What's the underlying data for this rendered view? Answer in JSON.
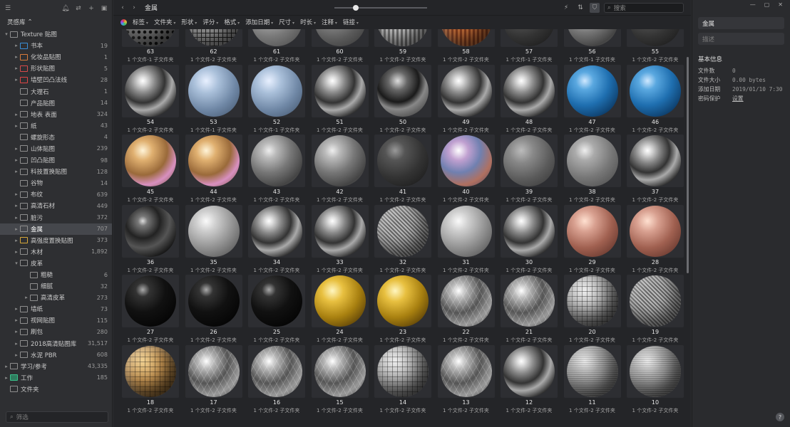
{
  "sidebar": {
    "library": "灵感库",
    "search_placeholder": "筛选",
    "items": [
      {
        "label": "Texture 贴图",
        "count": "",
        "depth": 0,
        "arrow": "▾",
        "icon": "folder-icon"
      },
      {
        "label": "书本",
        "count": "19",
        "depth": 1,
        "arrow": "▸",
        "icon": "book-icon"
      },
      {
        "label": "化妆品贴图",
        "count": "1",
        "depth": 1,
        "arrow": "▸",
        "icon": "cosmetics-icon"
      },
      {
        "label": "形状贴图",
        "count": "5",
        "depth": 1,
        "arrow": "▸",
        "icon": "shape-icon"
      },
      {
        "label": "墙壁凹凸法线",
        "count": "28",
        "depth": 1,
        "arrow": "▸",
        "icon": "warning-icon"
      },
      {
        "label": "大理石",
        "count": "1",
        "depth": 1,
        "arrow": "",
        "icon": "folder-icon"
      },
      {
        "label": "产品贴图",
        "count": "14",
        "depth": 1,
        "arrow": "",
        "icon": "folder-icon"
      },
      {
        "label": "地表 表面",
        "count": "324",
        "depth": 1,
        "arrow": "▸",
        "icon": "folder-icon"
      },
      {
        "label": "纸",
        "count": "43",
        "depth": 1,
        "arrow": "▸",
        "icon": "folder-icon"
      },
      {
        "label": "螺旋形态",
        "count": "4",
        "depth": 1,
        "arrow": "",
        "icon": "folder-icon"
      },
      {
        "label": "山体贴图",
        "count": "239",
        "depth": 1,
        "arrow": "▸",
        "icon": "folder-icon"
      },
      {
        "label": "凹凸贴图",
        "count": "98",
        "depth": 1,
        "arrow": "▸",
        "icon": "folder-icon"
      },
      {
        "label": "科技置换贴图",
        "count": "128",
        "depth": 1,
        "arrow": "▸",
        "icon": "folder-icon"
      },
      {
        "label": "谷物",
        "count": "14",
        "depth": 1,
        "arrow": "",
        "icon": "folder-icon"
      },
      {
        "label": "布纹",
        "count": "639",
        "depth": 1,
        "arrow": "▸",
        "icon": "folder-icon"
      },
      {
        "label": "高清石材",
        "count": "449",
        "depth": 1,
        "arrow": "▸",
        "icon": "folder-icon"
      },
      {
        "label": "脏污",
        "count": "372",
        "depth": 1,
        "arrow": "▸",
        "icon": "folder-icon"
      },
      {
        "label": "金属",
        "count": "707",
        "depth": 1,
        "arrow": "▸",
        "icon": "folder-icon",
        "selected": true
      },
      {
        "label": "高强度置换贴图",
        "count": "373",
        "depth": 1,
        "arrow": "▸",
        "icon": "displacement-icon"
      },
      {
        "label": "木材",
        "count": "1,892",
        "depth": 1,
        "arrow": "▸",
        "icon": "folder-icon"
      },
      {
        "label": "皮革",
        "count": "",
        "depth": 1,
        "arrow": "▾",
        "icon": "folder-icon"
      },
      {
        "label": "粗糙",
        "count": "6",
        "depth": 2,
        "arrow": "",
        "icon": "folder-icon"
      },
      {
        "label": "细腻",
        "count": "32",
        "depth": 2,
        "arrow": "",
        "icon": "folder-icon"
      },
      {
        "label": "高清皮革",
        "count": "273",
        "depth": 2,
        "arrow": "▸",
        "icon": "folder-icon"
      },
      {
        "label": "墙纸",
        "count": "73",
        "depth": 1,
        "arrow": "▸",
        "icon": "folder-icon"
      },
      {
        "label": "视网贴图",
        "count": "115",
        "depth": 1,
        "arrow": "▸",
        "icon": "folder-icon"
      },
      {
        "label": "刷包",
        "count": "280",
        "depth": 1,
        "arrow": "▸",
        "icon": "folder-icon"
      },
      {
        "label": "2018高清贴图库",
        "count": "31,517",
        "depth": 1,
        "arrow": "▸",
        "icon": "folder-icon"
      },
      {
        "label": "水泥 PBR",
        "count": "608",
        "depth": 1,
        "arrow": "▸",
        "icon": "folder-icon"
      },
      {
        "label": "学习/参考",
        "count": "43,335",
        "depth": 0,
        "arrow": "▸",
        "icon": "folder-icon"
      },
      {
        "label": "工作",
        "count": "185",
        "depth": 0,
        "arrow": "▸",
        "icon": "work-icon"
      },
      {
        "label": "文件夹",
        "count": "",
        "depth": 0,
        "arrow": "",
        "icon": "folder-icon"
      }
    ]
  },
  "toolbar": {
    "title": "金属",
    "search_placeholder": "搜索",
    "zoom_level": 0.2
  },
  "filters": [
    "标签",
    "文件夹",
    "形状",
    "评分",
    "格式",
    "添加日期",
    "尺寸",
    "时长",
    "注释",
    "链接"
  ],
  "items": [
    {
      "name": "63",
      "sub": "1 个文件-1 子文件夹",
      "mat": "perforated"
    },
    {
      "name": "62",
      "sub": "1 个文件-2 子文件夹",
      "mat": "grid"
    },
    {
      "name": "61",
      "sub": "1 个文件-2 子文件夹",
      "mat": "scuffed"
    },
    {
      "name": "60",
      "sub": "1 个文件-2 子文件夹",
      "mat": "rough"
    },
    {
      "name": "59",
      "sub": "1 个文件-2 子文件夹",
      "mat": "stripes"
    },
    {
      "name": "58",
      "sub": "1 个文件-2 子文件夹",
      "mat": "rust"
    },
    {
      "name": "57",
      "sub": "1 个文件-1 子文件夹",
      "mat": "dark"
    },
    {
      "name": "56",
      "sub": "1 个文件-1 子文件夹",
      "mat": "steel"
    },
    {
      "name": "55",
      "sub": "1 个文件-2 子文件夹",
      "mat": "dark"
    },
    {
      "name": "54",
      "sub": "1 个文件-2 子文件夹",
      "mat": "chrome"
    },
    {
      "name": "53",
      "sub": "1 个文件-1 子文件夹",
      "mat": "bluetile"
    },
    {
      "name": "52",
      "sub": "1 个文件-1 子文件夹",
      "mat": "bluetile"
    },
    {
      "name": "51",
      "sub": "1 个文件-2 子文件夹",
      "mat": "chrome"
    },
    {
      "name": "50",
      "sub": "1 个文件-2 子文件夹",
      "mat": "marble"
    },
    {
      "name": "49",
      "sub": "1 个文件-2 子文件夹",
      "mat": "chrome"
    },
    {
      "name": "48",
      "sub": "1 个文件-2 子文件夹",
      "mat": "chrome"
    },
    {
      "name": "47",
      "sub": "1 个文件-2 子文件夹",
      "mat": "blue"
    },
    {
      "name": "46",
      "sub": "1 个文件-2 子文件夹",
      "mat": "blue"
    },
    {
      "name": "45",
      "sub": "1 个文件-2 子文件夹",
      "mat": "oil"
    },
    {
      "name": "44",
      "sub": "1 个文件-2 子文件夹",
      "mat": "oil"
    },
    {
      "name": "43",
      "sub": "1 个文件-2 子文件夹",
      "mat": "steel"
    },
    {
      "name": "42",
      "sub": "1 个文件-2 子文件夹",
      "mat": "steel"
    },
    {
      "name": "41",
      "sub": "1 个文件-2 子文件夹",
      "mat": "dark"
    },
    {
      "name": "40",
      "sub": "1 个文件-2 子文件夹",
      "mat": "iridescent"
    },
    {
      "name": "39",
      "sub": "1 个文件-2 子文件夹",
      "mat": "rough"
    },
    {
      "name": "38",
      "sub": "1 个文件-2 子文件夹",
      "mat": "scuffed"
    },
    {
      "name": "37",
      "sub": "1 个文件-2 子文件夹",
      "mat": "chrome"
    },
    {
      "name": "36",
      "sub": "1 个文件-2 子文件夹",
      "mat": "darkchrome"
    },
    {
      "name": "35",
      "sub": "1 个文件-2 子文件夹",
      "mat": "silver"
    },
    {
      "name": "34",
      "sub": "1 个文件-2 子文件夹",
      "mat": "chrome"
    },
    {
      "name": "33",
      "sub": "1 个文件-2 子文件夹",
      "mat": "chrome"
    },
    {
      "name": "32",
      "sub": "1 个文件-2 子文件夹",
      "mat": "woven"
    },
    {
      "name": "31",
      "sub": "1 个文件-2 子文件夹",
      "mat": "silver"
    },
    {
      "name": "30",
      "sub": "1 个文件-2 子文件夹",
      "mat": "chrome"
    },
    {
      "name": "29",
      "sub": "1 个文件-2 子文件夹",
      "mat": "copper"
    },
    {
      "name": "28",
      "sub": "1 个文件-2 子文件夹",
      "mat": "copper"
    },
    {
      "name": "27",
      "sub": "1 个文件-2 子文件夹",
      "mat": "black"
    },
    {
      "name": "26",
      "sub": "1 个文件-2 子文件夹",
      "mat": "black"
    },
    {
      "name": "25",
      "sub": "1 个文件-2 子文件夹",
      "mat": "black"
    },
    {
      "name": "24",
      "sub": "1 个文件-2 子文件夹",
      "mat": "gold"
    },
    {
      "name": "23",
      "sub": "1 个文件-2 子文件夹",
      "mat": "gold"
    },
    {
      "name": "22",
      "sub": "1 个文件-2 子文件夹",
      "mat": "hexchrome"
    },
    {
      "name": "21",
      "sub": "1 个文件-2 子文件夹",
      "mat": "hexchrome"
    },
    {
      "name": "20",
      "sub": "1 个文件-2 子文件夹",
      "mat": "tiles"
    },
    {
      "name": "19",
      "sub": "1 个文件-2 子文件夹",
      "mat": "woven"
    },
    {
      "name": "18",
      "sub": "1 个文件-2 子文件夹",
      "mat": "goldtiles"
    },
    {
      "name": "17",
      "sub": "1 个文件-2 子文件夹",
      "mat": "hexchrome"
    },
    {
      "name": "16",
      "sub": "1 个文件-2 子文件夹",
      "mat": "hexchrome"
    },
    {
      "name": "15",
      "sub": "1 个文件-2 子文件夹",
      "mat": "hexchrome"
    },
    {
      "name": "14",
      "sub": "1 个文件-2 子文件夹",
      "mat": "tiles"
    },
    {
      "name": "13",
      "sub": "1 个文件-2 子文件夹",
      "mat": "hexchrome"
    },
    {
      "name": "12",
      "sub": "1 个文件-2 子文件夹",
      "mat": "chrome"
    },
    {
      "name": "11",
      "sub": "1 个文件-2 子文件夹",
      "mat": "brushed"
    },
    {
      "name": "10",
      "sub": "1 个文件-2 子文件夹",
      "mat": "brushed"
    }
  ],
  "inspector": {
    "name": "金属",
    "note_placeholder": "描述",
    "section": "基本信息",
    "rows": [
      {
        "k": "文件数",
        "v": "0"
      },
      {
        "k": "文件大小",
        "v": "0.00 bytes"
      },
      {
        "k": "添加日期",
        "v": "2019/01/10 7:30"
      },
      {
        "k": "密码保护",
        "v": "设置",
        "link": true
      }
    ]
  },
  "colors": {
    "selection": "#45474c",
    "panel": "#2e2f32",
    "grid_bg": "#242528"
  }
}
